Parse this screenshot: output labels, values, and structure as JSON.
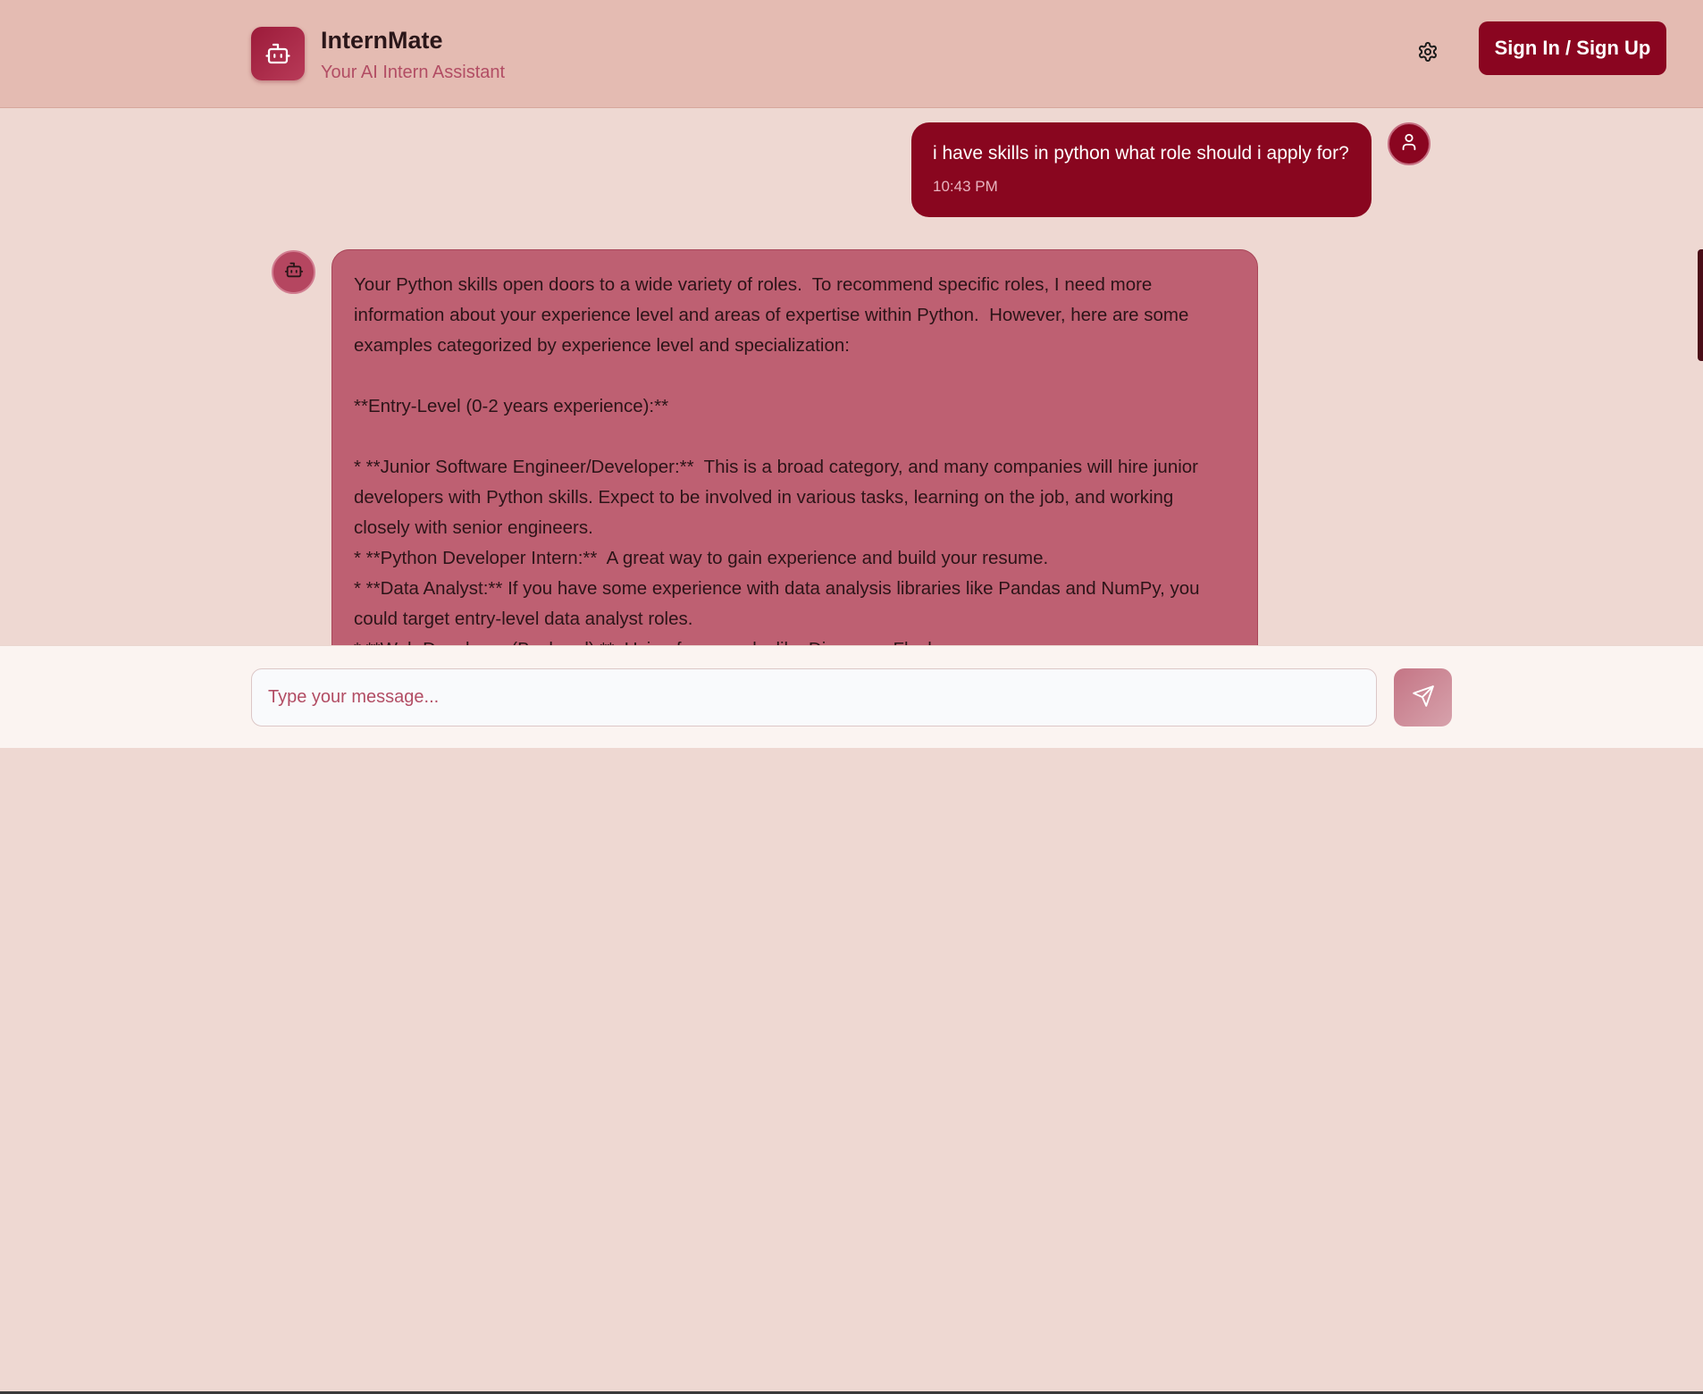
{
  "header": {
    "title": "InternMate",
    "subtitle": "Your AI Intern Assistant",
    "settings_icon": "gear-icon",
    "signin_label": "Sign In / Sign Up"
  },
  "colors": {
    "brand": "#8a0520",
    "header_bg": "#e4bbb2",
    "chat_bg": "#eed8d2",
    "bot_bubble": "#be6072",
    "accent_text": "#b24d64"
  },
  "messages": {
    "user": {
      "text": "i have skills in python what role should i apply for?",
      "time": "10:43 PM",
      "avatar_icon": "user-icon"
    },
    "bot": {
      "avatar_icon": "robot-icon",
      "lines": [
        "Your Python skills open doors to a wide variety of roles.  To recommend specific roles, I need more",
        "information about your experience level and areas of expertise within Python.  However, here are some",
        "examples categorized by experience level and specialization:",
        "",
        "**Entry-Level (0-2 years experience):**",
        "",
        "* **Junior Software Engineer/Developer:**  This is a broad category, and many companies will hire junior",
        "developers with Python skills. Expect to be involved in various tasks, learning on the job, and working",
        "closely with senior engineers.",
        "* **Python Developer Intern:**  A great way to gain experience and build your resume.",
        "* **Data Analyst:** If you have some experience with data analysis libraries like Pandas and NumPy, you",
        "could target entry-level data analyst roles.",
        "* **Web Developer (Backend):**  Using frameworks like Django or Flask"
      ]
    }
  },
  "composer": {
    "placeholder": "Type your message...",
    "send_icon": "send-icon"
  }
}
